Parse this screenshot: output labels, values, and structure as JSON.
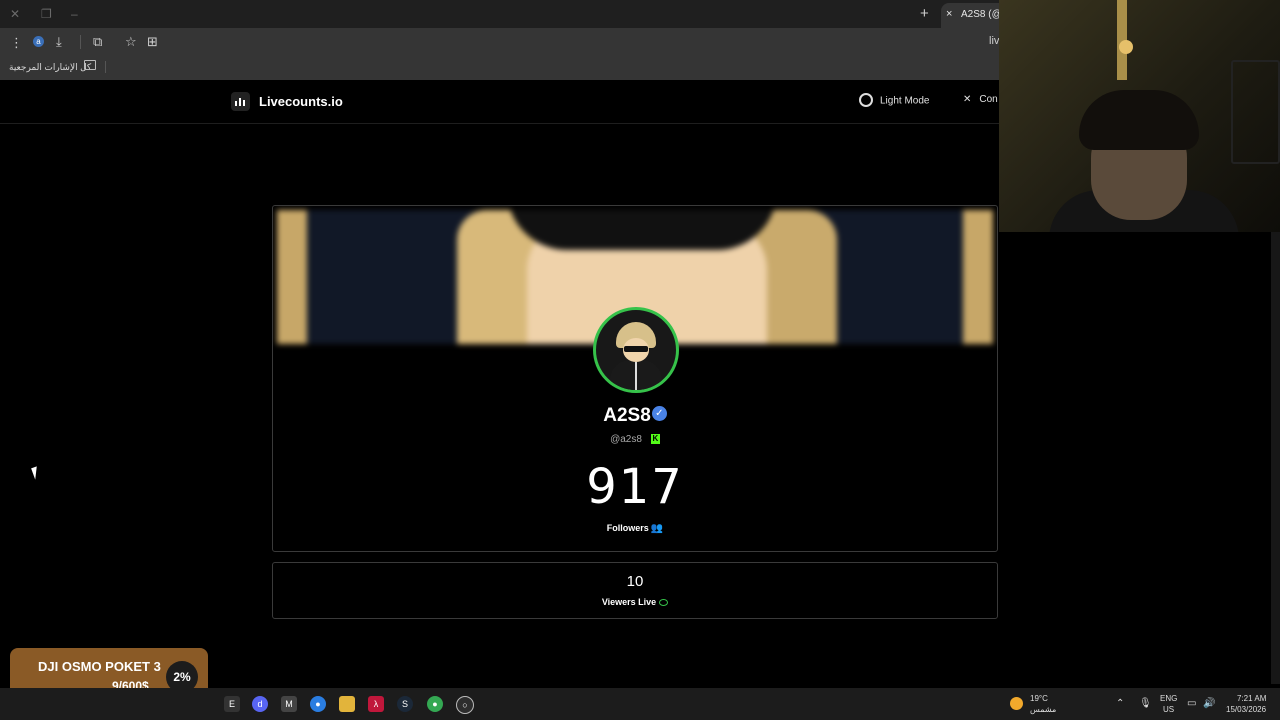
{
  "browser": {
    "tab_title": "A2S8 (@a2",
    "tab_close": "×",
    "new_tab": "+",
    "address_partial": "liv",
    "bookmarks_label": "كل الإشارات المرجعية",
    "profile_initial": "a"
  },
  "site": {
    "logo_text": "Livecounts.io",
    "light_mode_label": "Light Mode",
    "contact_label": "Con"
  },
  "profile": {
    "display_name": "A2S8",
    "handle": "@a2s8",
    "platform_badge": "K",
    "follower_count": "917",
    "followers_label": "Followers",
    "viewers_count": "10",
    "viewers_label": "Viewers Live"
  },
  "donation": {
    "title": "DJI OSMO POKET 3",
    "amount": "9/600$",
    "percent": "2%"
  },
  "taskbar": {
    "temperature": "19°C",
    "weather_text": "مشمس",
    "lang_top": "ENG",
    "lang_bottom": "US",
    "time": "7:21 AM",
    "date": "15/03/2026"
  },
  "colors": {
    "accent_green": "#36c24a",
    "verified_blue": "#4a83e6",
    "kick_green": "#53fc18",
    "donation_bg": "#8a5a26"
  }
}
